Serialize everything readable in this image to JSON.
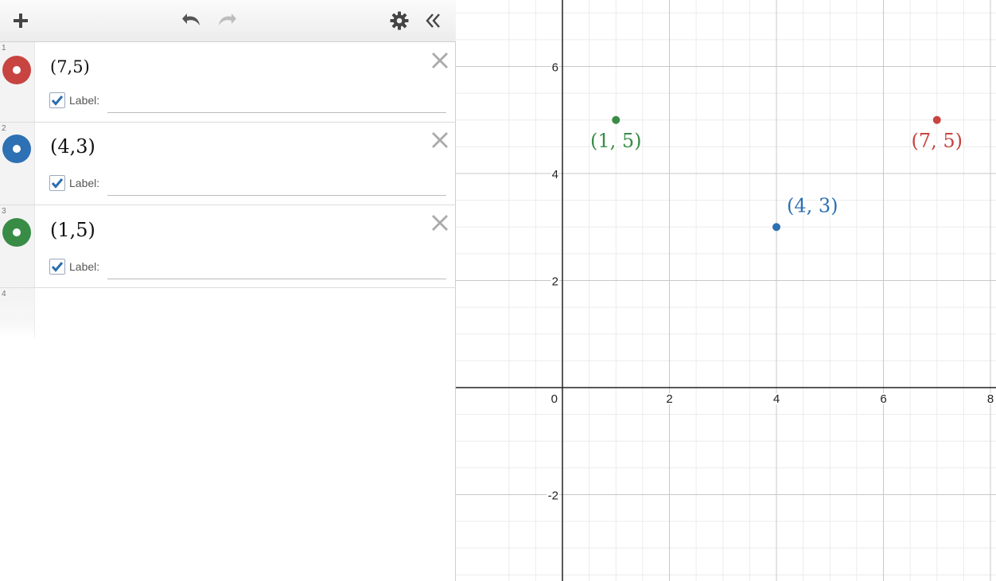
{
  "toolbar": {
    "add_icon": "plus-icon",
    "undo_icon": "undo-icon",
    "redo_icon": "redo-icon",
    "settings_icon": "gear-icon",
    "collapse_icon": "double-chevron-left-icon"
  },
  "expressions": [
    {
      "index": "1",
      "latex_display": "(7,5)",
      "color": "#c74440",
      "label_checkbox": true,
      "label_text": "Label:",
      "label_value": ""
    },
    {
      "index": "2",
      "latex_display": "(4,3)",
      "color": "#2d70b3",
      "label_checkbox": true,
      "label_text": "Label:",
      "label_value": ""
    },
    {
      "index": "3",
      "latex_display": "(1,5)",
      "color": "#388c46",
      "label_checkbox": true,
      "label_text": "Label:",
      "label_value": ""
    },
    {
      "index": "4"
    }
  ],
  "chart_data": {
    "type": "scatter",
    "xlim": [
      -1,
      8
    ],
    "ylim": [
      -3.6,
      7.2
    ],
    "grid": true,
    "minor_grid": true,
    "x_ticks": [
      "0",
      "2",
      "4",
      "6",
      "8"
    ],
    "y_ticks": [
      "-2",
      "2",
      "4",
      "6"
    ],
    "points": [
      {
        "x": 7,
        "y": 5,
        "label": "(7, 5)",
        "color": "#c74440"
      },
      {
        "x": 4,
        "y": 3,
        "label": "(4, 3)",
        "color": "#2d70b3"
      },
      {
        "x": 1,
        "y": 5,
        "label": "(1, 5)",
        "color": "#388c46"
      }
    ]
  }
}
